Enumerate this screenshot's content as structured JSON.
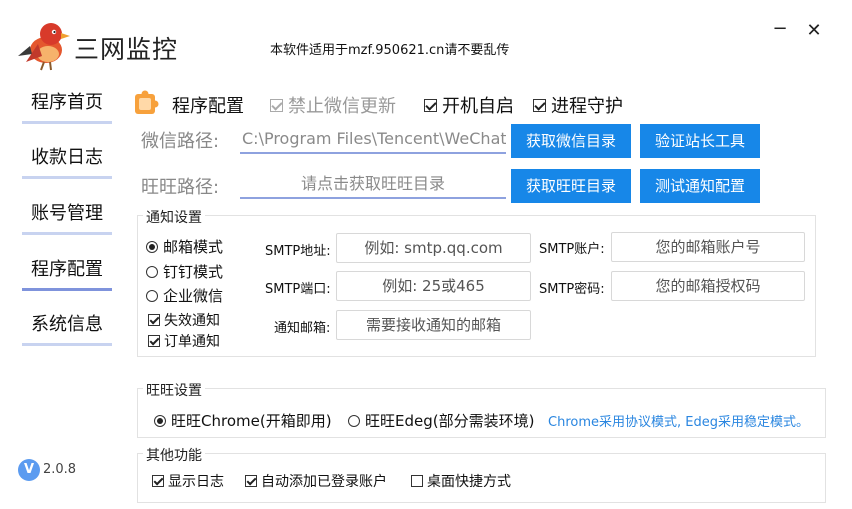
{
  "header": {
    "app_title": "三网监控",
    "notice": "本软件适用于mzf.950621.cn请不要乱传",
    "minimize_glyph": "−",
    "close_glyph": "✕"
  },
  "sidebar": {
    "items": [
      {
        "label": "程序首页"
      },
      {
        "label": "收款日志"
      },
      {
        "label": "账号管理"
      },
      {
        "label": "程序配置",
        "active": true
      },
      {
        "label": "系统信息"
      }
    ]
  },
  "version": {
    "icon_letter": "V",
    "label": "2.0.8"
  },
  "config": {
    "title": "程序配置",
    "options": {
      "disable_wechat_update": {
        "label": "禁止微信更新",
        "checked": true,
        "disabled": true
      },
      "autostart": {
        "label": "开机自启",
        "checked": true
      },
      "process_guard": {
        "label": "进程守护",
        "checked": true
      }
    },
    "wechat_path": {
      "label": "微信路径:",
      "value": "C:\\Program Files\\Tencent\\WeChat\\",
      "get_button": "获取微信目录",
      "verify_button": "验证站长工具"
    },
    "wangwang_path": {
      "label": "旺旺路径:",
      "placeholder": "请点击获取旺旺目录",
      "get_button": "获取旺旺目录",
      "test_button": "测试通知配置"
    }
  },
  "notify": {
    "title": "通知设置",
    "modes": [
      {
        "label": "邮箱模式",
        "selected": true
      },
      {
        "label": "钉钉模式",
        "selected": false
      },
      {
        "label": "企业微信",
        "selected": false
      }
    ],
    "options": [
      {
        "label": "失效通知",
        "checked": true
      },
      {
        "label": "订单通知",
        "checked": true
      }
    ],
    "smtp_host": {
      "label": "SMTP地址:",
      "placeholder": "例如: smtp.qq.com"
    },
    "smtp_port": {
      "label": "SMTP端口:",
      "placeholder": "例如: 25或465"
    },
    "notify_email": {
      "label": "通知邮箱:",
      "placeholder": "需要接收通知的邮箱"
    },
    "smtp_account": {
      "label": "SMTP账户:",
      "placeholder": "您的邮箱账户号"
    },
    "smtp_password": {
      "label": "SMTP密码:",
      "placeholder": "您的邮箱授权码"
    }
  },
  "wangwang": {
    "title": "旺旺设置",
    "modes": [
      {
        "label": "旺旺Chrome(开箱即用)",
        "selected": true
      },
      {
        "label": "旺旺Edeg(部分需装环境)",
        "selected": false
      }
    ],
    "note": "Chrome采用协议模式, Edeg采用稳定模式。"
  },
  "other": {
    "title": "其他功能",
    "options": [
      {
        "label": "显示日志",
        "checked": true
      },
      {
        "label": "自动添加已登录账户",
        "checked": true
      },
      {
        "label": "桌面快捷方式",
        "checked": false
      }
    ]
  },
  "colors": {
    "accent": "#1787e8",
    "sidebar_underline": "#c8d3f0",
    "sidebar_active": "#7f93dc",
    "note": "#2a86e0"
  }
}
